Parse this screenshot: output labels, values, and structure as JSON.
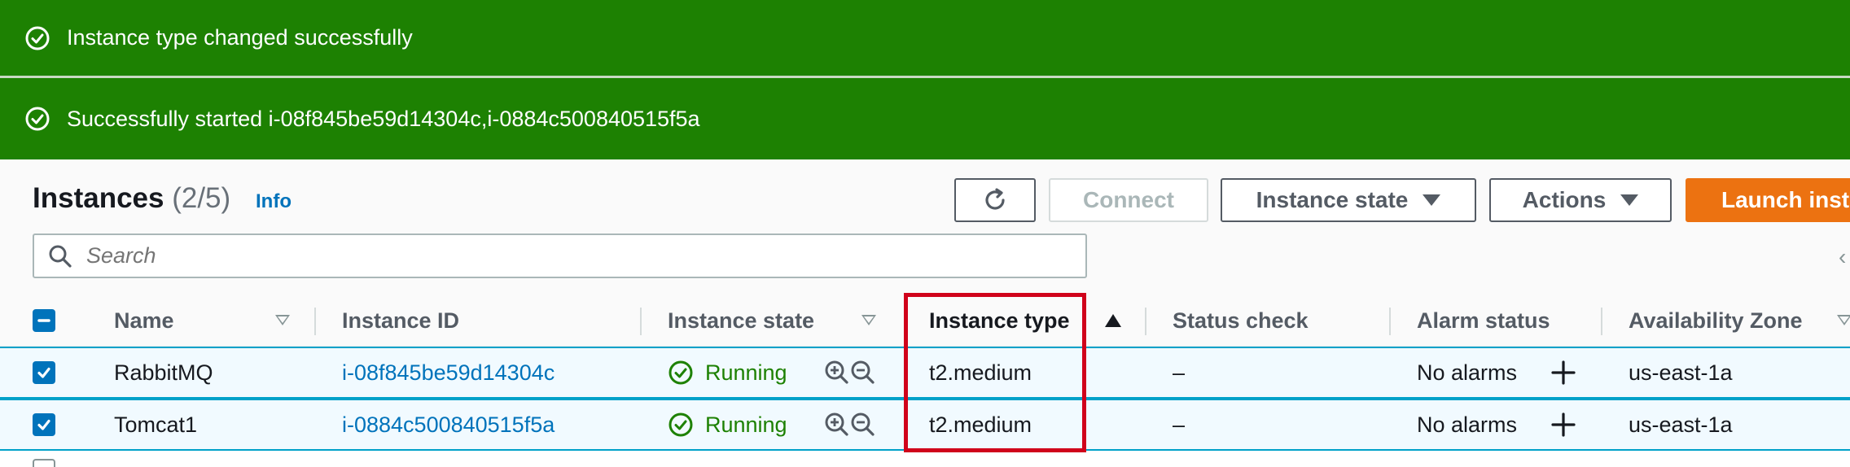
{
  "flash": {
    "message_1": "Instance type changed successfully",
    "message_2": "Successfully started i-08f845be59d14304c,i-0884c500840515f5a",
    "color": "#1d8102"
  },
  "header": {
    "title": "Instances",
    "count": "(2/5)",
    "info_link": "Info"
  },
  "toolbar": {
    "refresh_icon": "refresh-icon",
    "connect_label": "Connect",
    "instance_state_label": "Instance state",
    "actions_label": "Actions",
    "launch_label": "Launch insta",
    "launch_color": "#ec7211"
  },
  "search": {
    "placeholder": "Search"
  },
  "table": {
    "columns": {
      "name": "Name",
      "instance_id": "Instance ID",
      "instance_state": "Instance state",
      "instance_type": "Instance type",
      "status_check": "Status check",
      "alarm_status": "Alarm status",
      "availability_zone": "Availability Zone"
    },
    "rows": [
      {
        "selected": true,
        "name": "RabbitMQ",
        "instance_id": "i-08f845be59d14304c",
        "state": "Running",
        "type": "t2.medium",
        "status_check": "–",
        "alarm_status": "No alarms",
        "zone": "us-east-1a"
      },
      {
        "selected": true,
        "name": "Tomcat1",
        "instance_id": "i-0884c500840515f5a",
        "state": "Running",
        "type": "t2.medium",
        "status_check": "–",
        "alarm_status": "No alarms",
        "zone": "us-east-1a"
      }
    ]
  },
  "annotation": {
    "highlight_color": "#d0021b"
  }
}
